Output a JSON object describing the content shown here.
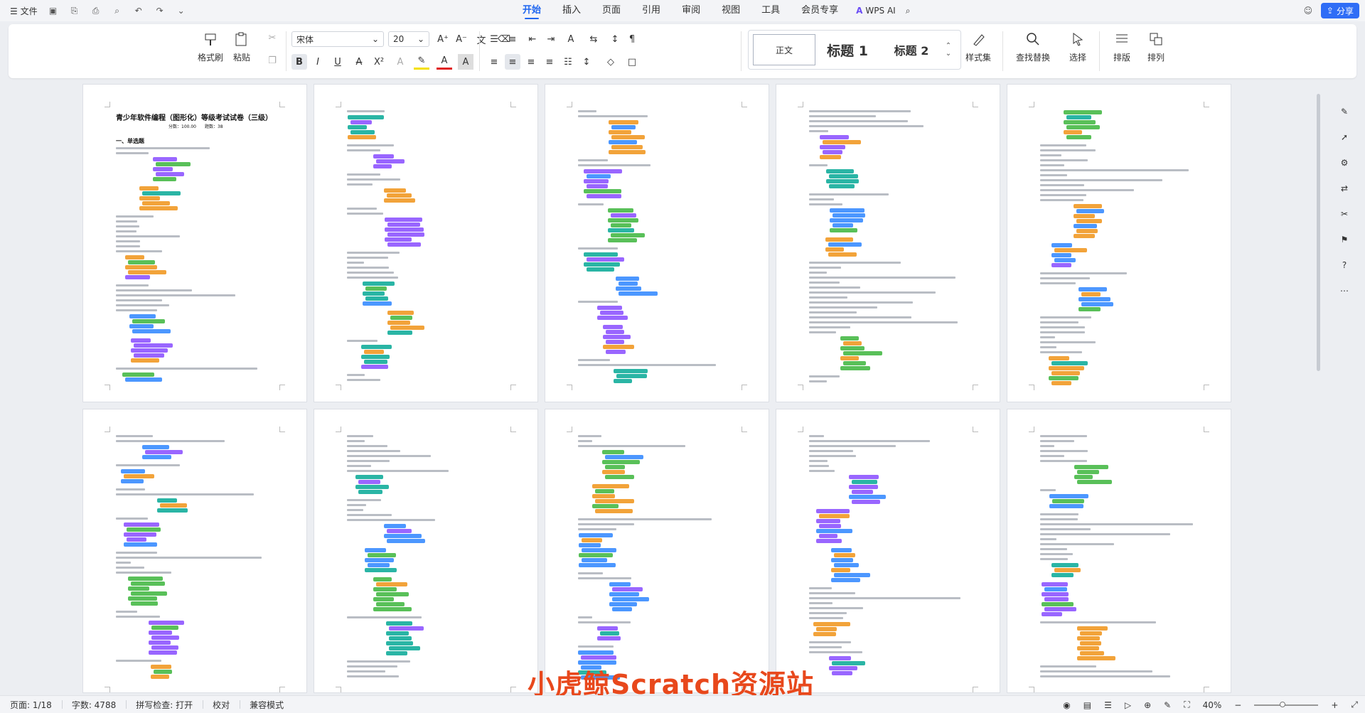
{
  "titlebar": {
    "file_menu": "文件",
    "tabs": [
      "开始",
      "插入",
      "页面",
      "引用",
      "审阅",
      "视图",
      "工具",
      "会员专享"
    ],
    "active_tab": "开始",
    "wps_ai": "WPS AI",
    "share": "分享"
  },
  "ribbon": {
    "format_painter": "格式刷",
    "paste": "粘贴",
    "font_name": "宋体",
    "font_size": "20",
    "style_normal": "正文",
    "style_h1": "标题 1",
    "style_h2": "标题 2",
    "styles_set": "样式集",
    "find_replace": "查找替换",
    "select": "选择",
    "layout": "排版",
    "arrange": "排列"
  },
  "document": {
    "page1_title": "青少年软件编程（图形化）等级考试试卷（三级）",
    "page1_subtitle": "分数：100.00　　题数：38",
    "page1_section": "一、单选题"
  },
  "watermark": "小虎鲸Scratch资源站",
  "statusbar": {
    "page": "页面: 1/18",
    "words": "字数: 4788",
    "spell": "拼写检查: 打开",
    "proof": "校对",
    "compat": "兼容模式",
    "zoom": "40%",
    "zoom_level": 0.4
  },
  "colors": {
    "accent": "#1f66f0",
    "share_bg": "#2f6df6",
    "watermark": "#e8481c",
    "block_orange": "#f2a33a",
    "block_blue": "#4c97ff",
    "block_purple": "#9966ff",
    "block_green": "#59c059",
    "block_teal": "#2ab5a5"
  }
}
